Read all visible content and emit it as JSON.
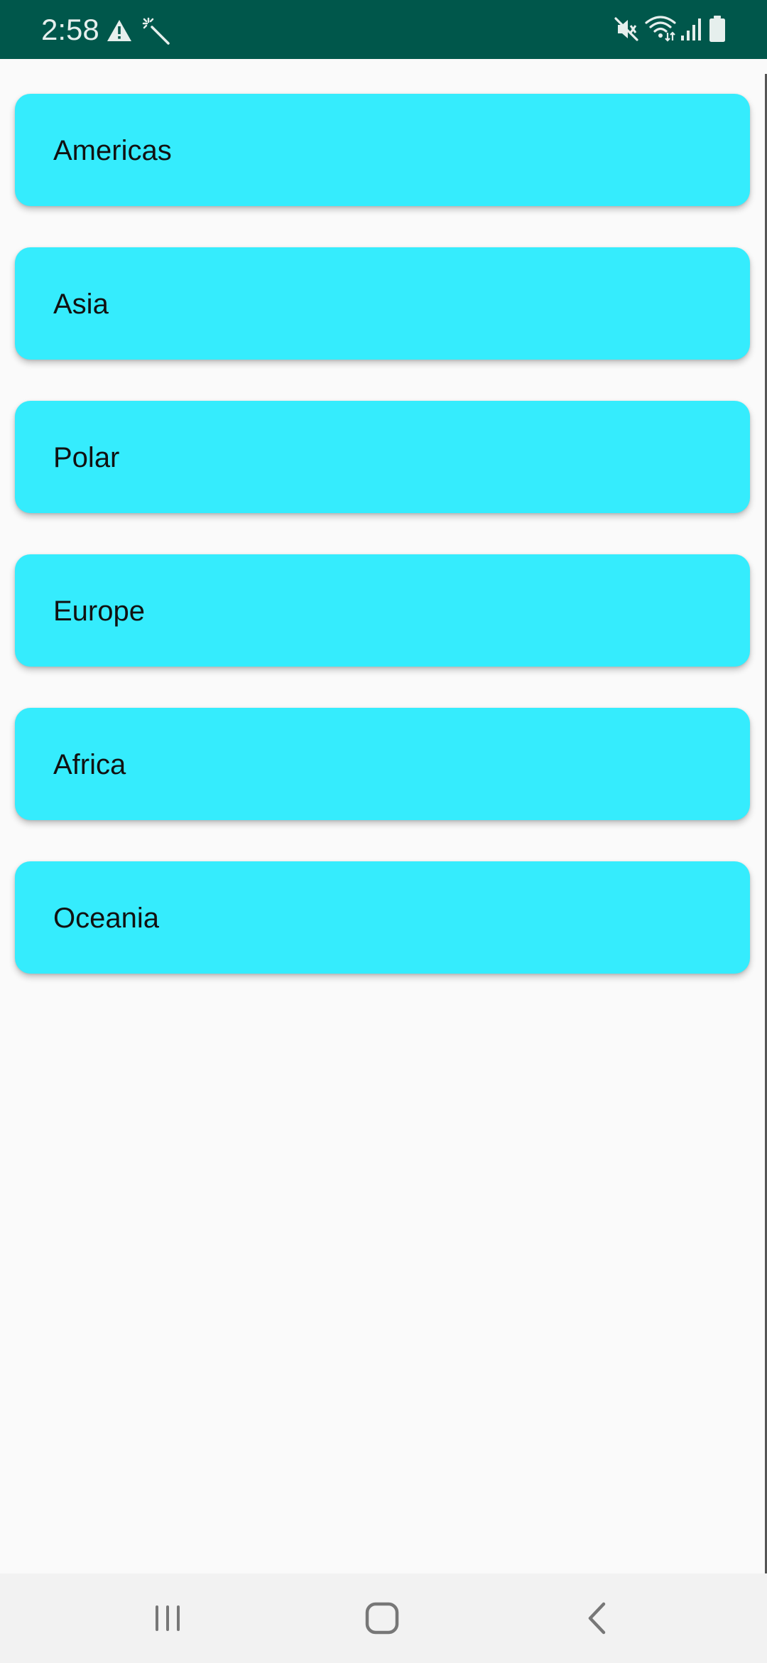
{
  "status_bar": {
    "time": "2:58",
    "background": "#00574b",
    "left_icons": [
      "warning-icon",
      "magic-wand-icon"
    ],
    "right_icons": [
      "mute-icon",
      "wifi-icon",
      "signal-icon",
      "battery-icon"
    ]
  },
  "regions": {
    "card_color": "#35ecfd",
    "items": [
      {
        "label": "Americas"
      },
      {
        "label": "Asia"
      },
      {
        "label": "Polar"
      },
      {
        "label": "Europe"
      },
      {
        "label": "Africa"
      },
      {
        "label": "Oceania"
      }
    ]
  },
  "nav_bar": {
    "buttons": [
      "recent-apps-icon",
      "home-icon",
      "back-icon"
    ]
  }
}
